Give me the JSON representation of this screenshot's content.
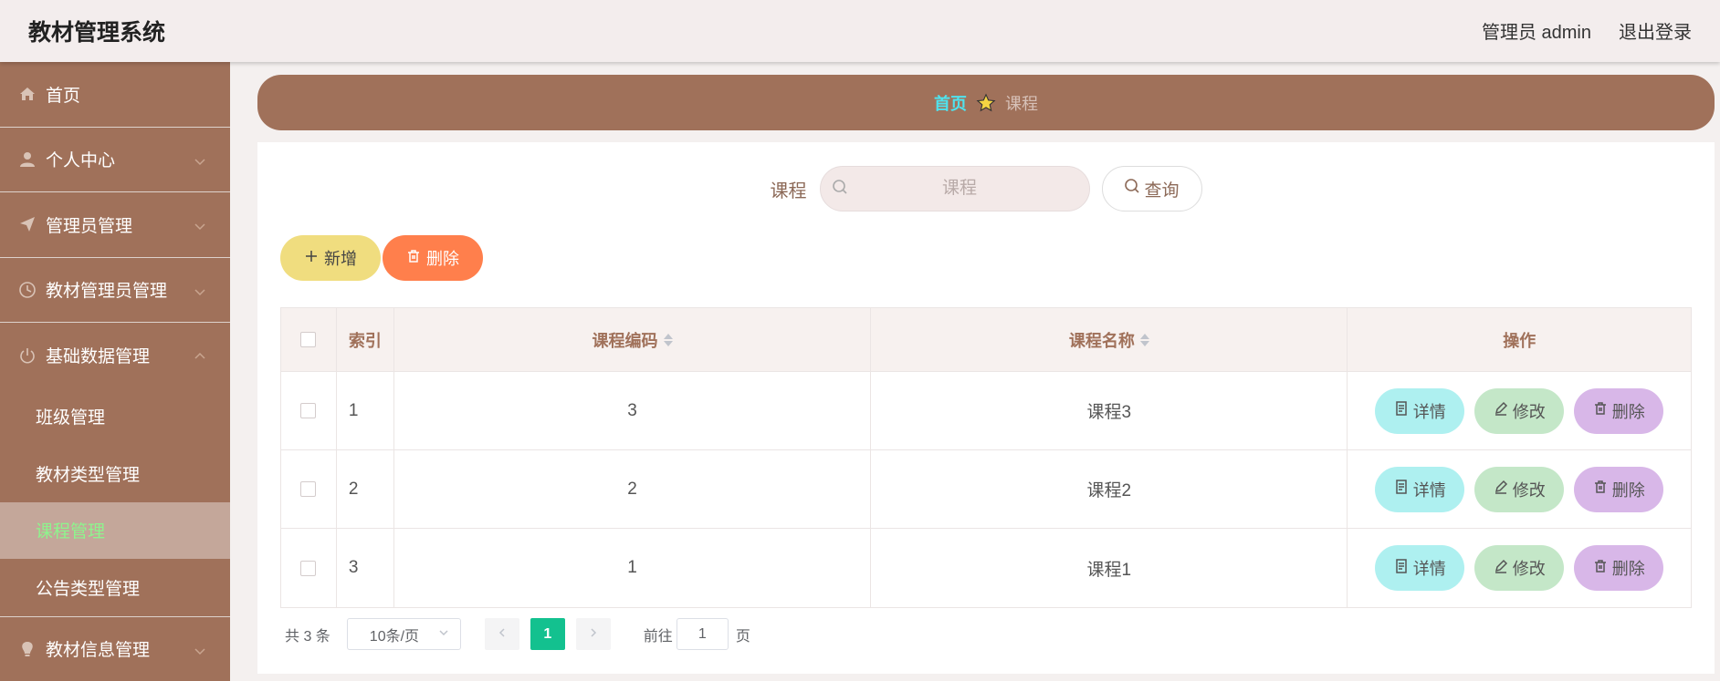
{
  "header": {
    "app_title": "教材管理系统",
    "user_label": "管理员 admin",
    "logout_label": "退出登录"
  },
  "sidebar": {
    "items": [
      {
        "label": "首页",
        "icon": "home-icon"
      },
      {
        "label": "个人中心",
        "icon": "user-icon"
      },
      {
        "label": "管理员管理",
        "icon": "send-icon"
      },
      {
        "label": "教材管理员管理",
        "icon": "clock-icon"
      },
      {
        "label": "基础数据管理",
        "icon": "power-icon"
      },
      {
        "label": "教材信息管理",
        "icon": "lightbulb-icon"
      }
    ],
    "sub_items": [
      {
        "label": "班级管理"
      },
      {
        "label": "教材类型管理"
      },
      {
        "label": "课程管理",
        "active": true
      },
      {
        "label": "公告类型管理"
      }
    ]
  },
  "breadcrumb": {
    "home": "首页",
    "current": "课程"
  },
  "search": {
    "label": "课程",
    "placeholder": "课程",
    "query_button": "查询"
  },
  "actions": {
    "add_label": "新增",
    "delete_label": "删除"
  },
  "table": {
    "columns": [
      "索引",
      "课程编码",
      "课程名称",
      "操作"
    ],
    "rows": [
      {
        "index": "1",
        "code": "3",
        "name": "课程3"
      },
      {
        "index": "2",
        "code": "2",
        "name": "课程2"
      },
      {
        "index": "3",
        "code": "1",
        "name": "课程1"
      }
    ],
    "row_actions": {
      "detail": "详情",
      "edit": "修改",
      "delete": "删除"
    }
  },
  "pagination": {
    "total_text": "共 3 条",
    "page_size": "10条/页",
    "current_page": "1",
    "goto_prefix": "前往",
    "goto_value": "1",
    "goto_suffix": "页"
  },
  "colors": {
    "sidebar_bg": "#a0715a",
    "active_sub_text": "#8df58d",
    "breadcrumb_home": "#4fe3ee",
    "add_button": "#f0dd7f",
    "delete_button": "#ff7f4c",
    "detail_button": "#aef0f0",
    "edit_button": "#c4e7c8",
    "row_delete_button": "#d8b7e8",
    "page_active": "#13c18f"
  }
}
